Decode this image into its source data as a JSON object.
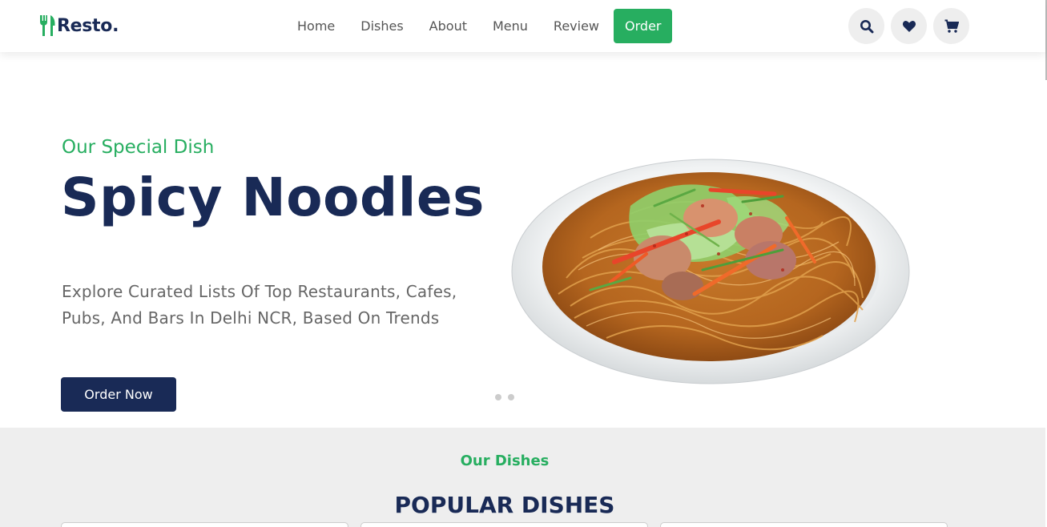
{
  "brand": {
    "name": "Resto."
  },
  "nav": {
    "items": [
      "Home",
      "Dishes",
      "About",
      "Menu",
      "Review"
    ],
    "active": "Order"
  },
  "header_icons": [
    "search-icon",
    "heart-icon",
    "cart-icon"
  ],
  "hero": {
    "subtitle": "Our Special Dish",
    "title": "Spicy Noodles",
    "description": "Explore Curated Lists Of Top Restaurants, Cafes, Pubs, And Bars In Delhi NCR, Based On Trends",
    "button": "Order Now",
    "slide_count": 2
  },
  "dishes": {
    "subtitle": "Our Dishes",
    "title": "POPULAR DISHES"
  },
  "colors": {
    "accent": "#27ae60",
    "primary": "#192a56",
    "text": "#666666",
    "section_bg": "#eeeeee"
  }
}
